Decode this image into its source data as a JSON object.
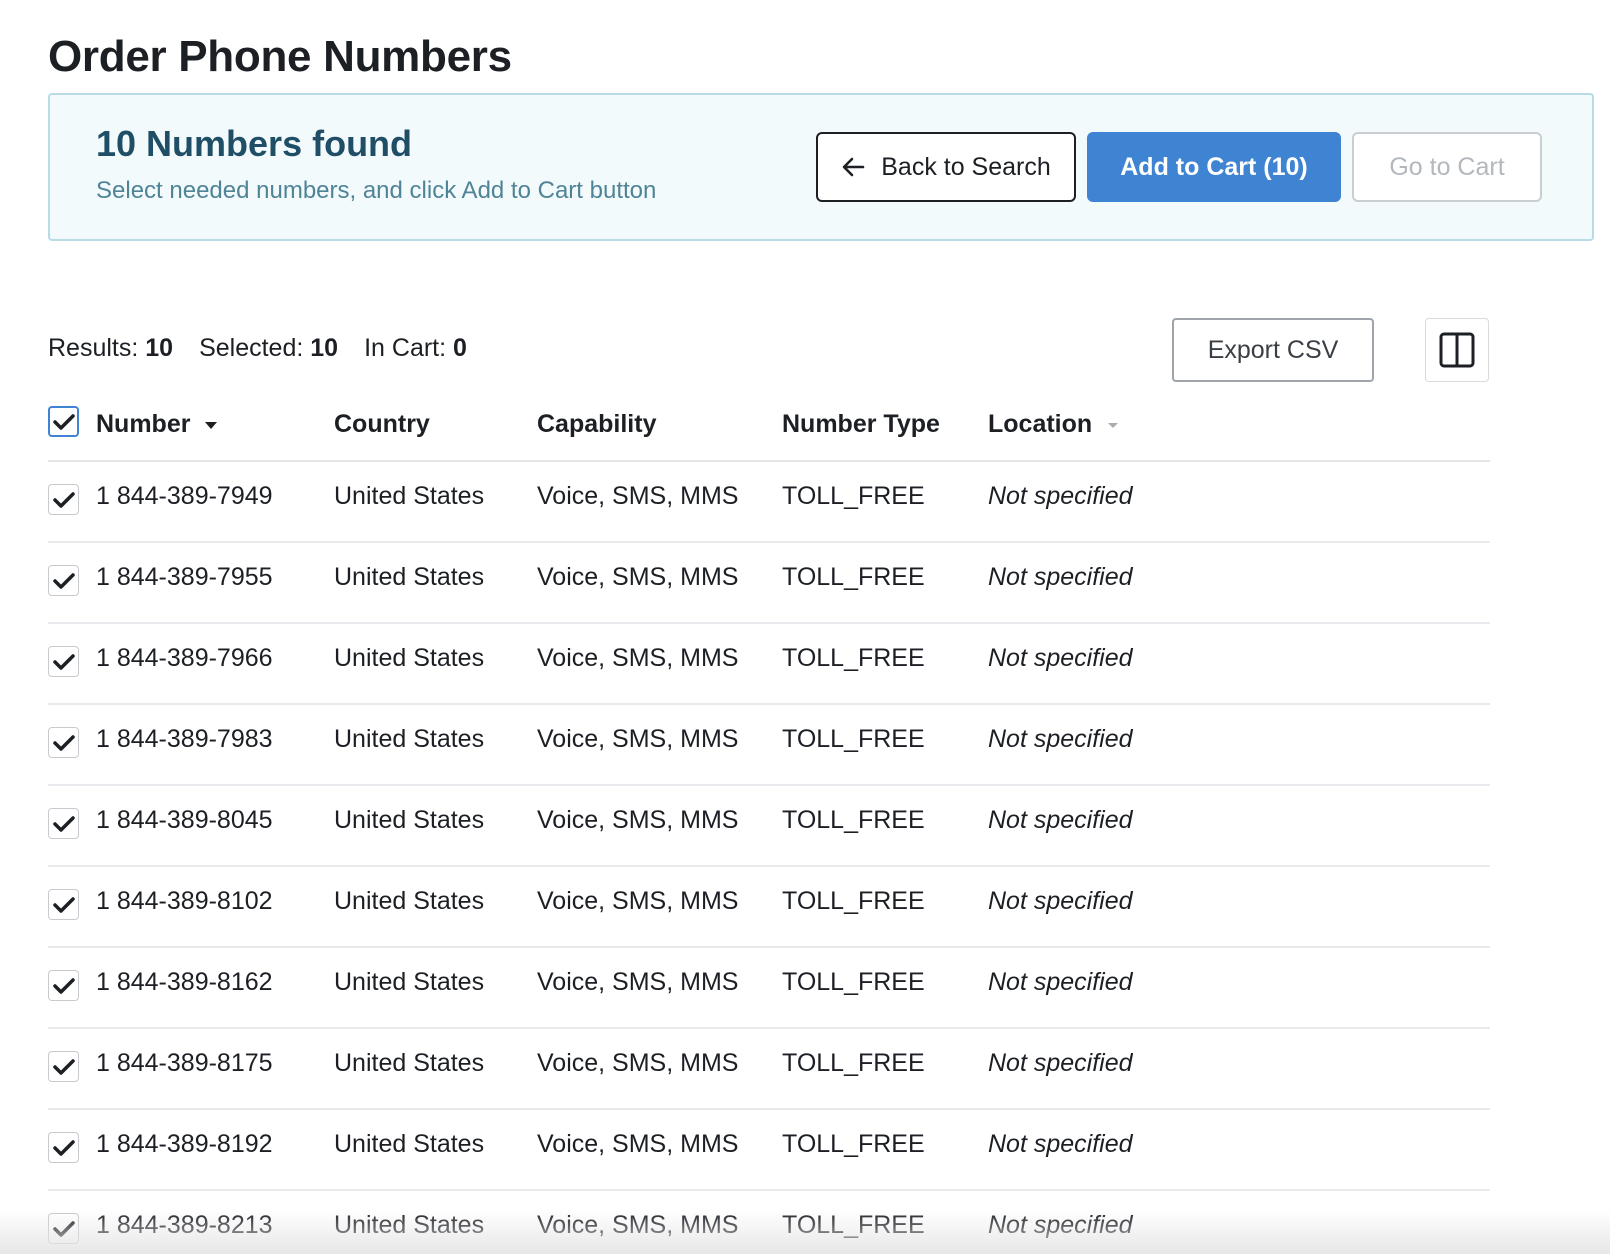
{
  "page": {
    "title": "Order Phone Numbers"
  },
  "banner": {
    "heading": "10 Numbers found",
    "subtitle": "Select needed numbers, and click Add to Cart button",
    "back_label": "Back to Search",
    "add_label": "Add to Cart (10)",
    "cart_label": "Go to Cart"
  },
  "summary": {
    "results_label": "Results:",
    "results_value": "10",
    "selected_label": "Selected:",
    "selected_value": "10",
    "incart_label": "In Cart:",
    "incart_value": "0"
  },
  "toolbar": {
    "export_label": "Export CSV",
    "columns_icon": "columns-icon"
  },
  "table": {
    "headers": {
      "number": "Number",
      "country": "Country",
      "capability": "Capability",
      "number_type": "Number Type",
      "location": "Location"
    },
    "rows": [
      {
        "number": "1 844-389-7949",
        "country": "United States",
        "capability": "Voice, SMS, MMS",
        "type": "TOLL_FREE",
        "location": "Not specified"
      },
      {
        "number": "1 844-389-7955",
        "country": "United States",
        "capability": "Voice, SMS, MMS",
        "type": "TOLL_FREE",
        "location": "Not specified"
      },
      {
        "number": "1 844-389-7966",
        "country": "United States",
        "capability": "Voice, SMS, MMS",
        "type": "TOLL_FREE",
        "location": "Not specified"
      },
      {
        "number": "1 844-389-7983",
        "country": "United States",
        "capability": "Voice, SMS, MMS",
        "type": "TOLL_FREE",
        "location": "Not specified"
      },
      {
        "number": "1 844-389-8045",
        "country": "United States",
        "capability": "Voice, SMS, MMS",
        "type": "TOLL_FREE",
        "location": "Not specified"
      },
      {
        "number": "1 844-389-8102",
        "country": "United States",
        "capability": "Voice, SMS, MMS",
        "type": "TOLL_FREE",
        "location": "Not specified"
      },
      {
        "number": "1 844-389-8162",
        "country": "United States",
        "capability": "Voice, SMS, MMS",
        "type": "TOLL_FREE",
        "location": "Not specified"
      },
      {
        "number": "1 844-389-8175",
        "country": "United States",
        "capability": "Voice, SMS, MMS",
        "type": "TOLL_FREE",
        "location": "Not specified"
      },
      {
        "number": "1 844-389-8192",
        "country": "United States",
        "capability": "Voice, SMS, MMS",
        "type": "TOLL_FREE",
        "location": "Not specified"
      },
      {
        "number": "1 844-389-8213",
        "country": "United States",
        "capability": "Voice, SMS, MMS",
        "type": "TOLL_FREE",
        "location": "Not specified"
      }
    ]
  },
  "colors": {
    "accent": "#3f84d2",
    "banner_bg": "#f3fafc",
    "banner_border": "#b9dbe6",
    "heading": "#1f4e66"
  }
}
